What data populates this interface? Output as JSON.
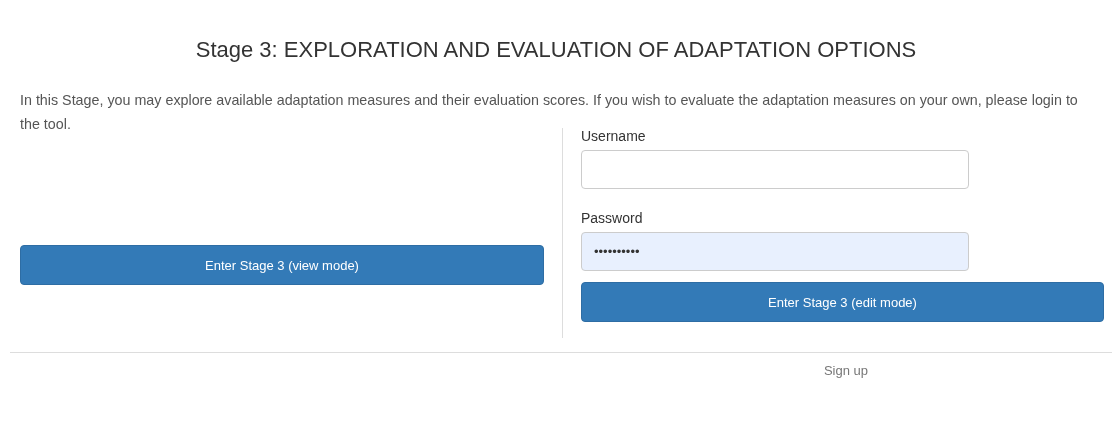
{
  "title": "Stage 3: EXPLORATION AND EVALUATION OF ADAPTATION OPTIONS",
  "intro": "In this Stage, you may explore available adaptation measures and their evaluation scores. If you wish to evaluate the adaptation measures on your own, please login to the tool.",
  "view_button": "Enter Stage 3 (view mode)",
  "login": {
    "fields": [
      {
        "label": "Username",
        "autofilled": false
      },
      {
        "label": "Password",
        "value": "••••••••••",
        "autofilled": true
      }
    ],
    "button": "Enter Stage 3 (edit mode)"
  },
  "signup_link": "Sign up"
}
